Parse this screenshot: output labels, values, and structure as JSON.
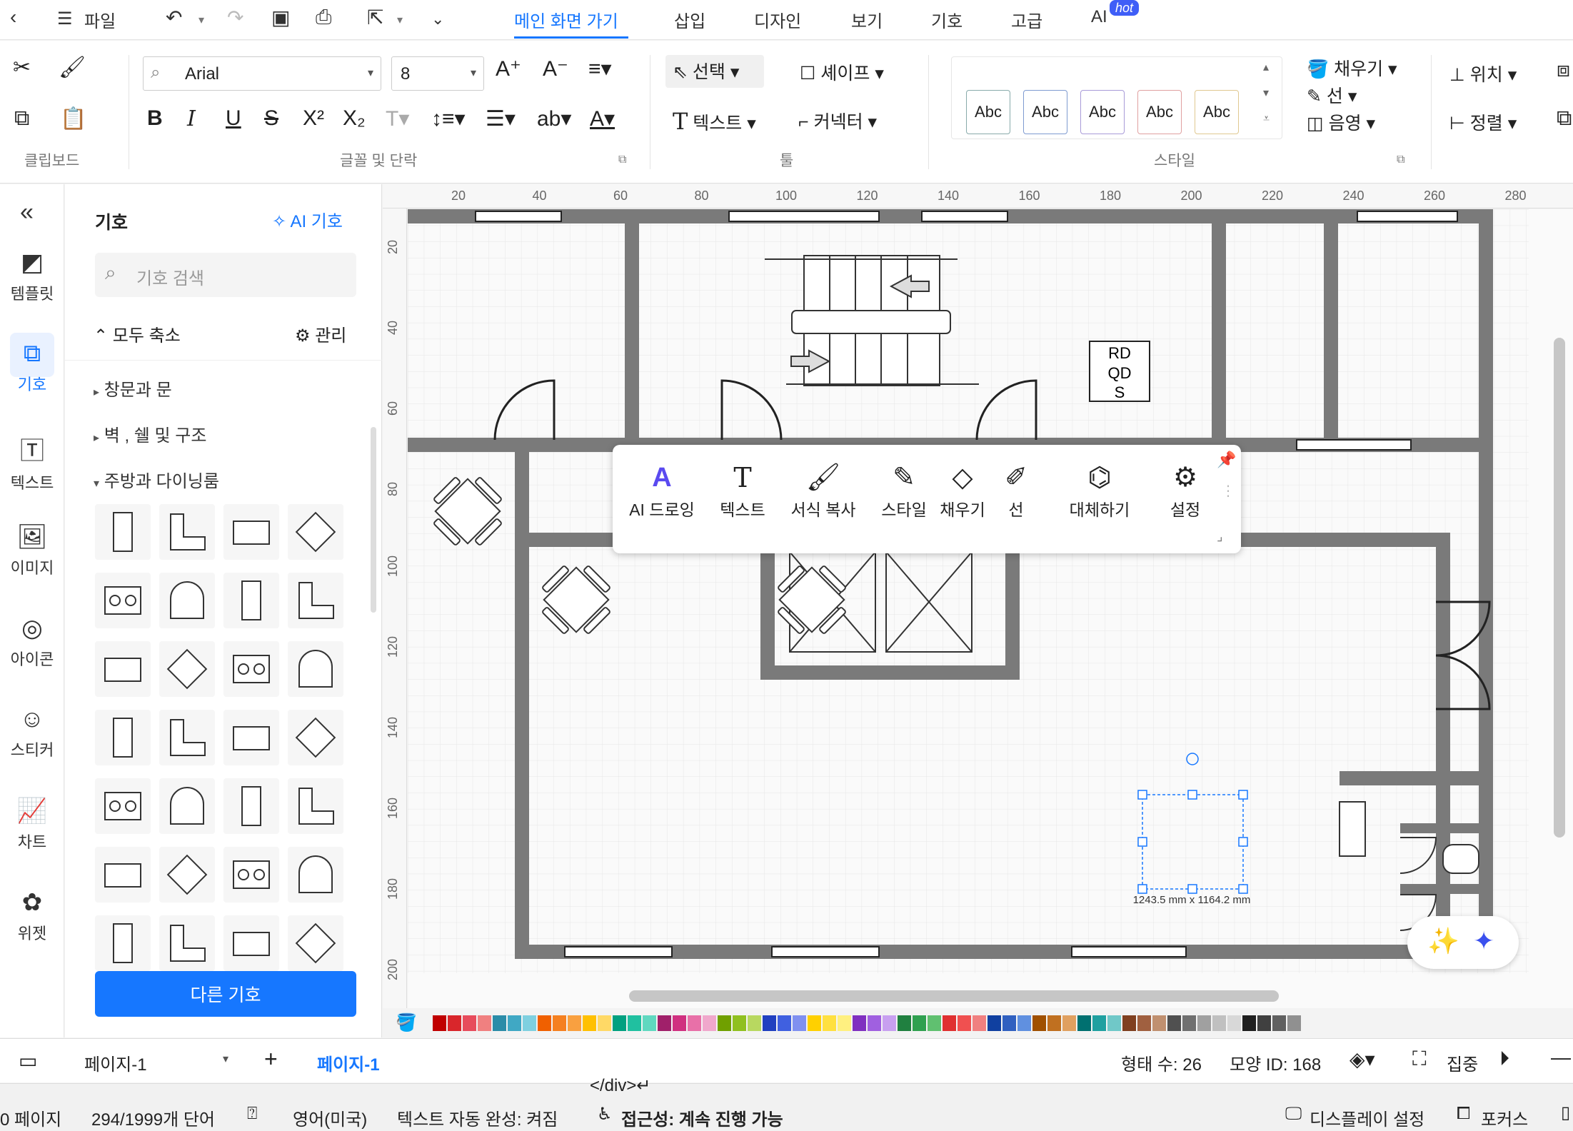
{
  "menubar": {
    "file": "파일",
    "tabs": [
      {
        "label": "메인 화면 가기",
        "active": true
      },
      {
        "label": "삽입"
      },
      {
        "label": "디자인"
      },
      {
        "label": "보기"
      },
      {
        "label": "기호"
      },
      {
        "label": "고급"
      },
      {
        "label": "AI"
      }
    ],
    "hot_badge": "hot"
  },
  "ribbon": {
    "clipboard_label": "클립보드",
    "font_label": "글꼴 및 단락",
    "tools_label": "툴",
    "style_label": "스타일",
    "font_name": "Arial",
    "font_size": "8",
    "select": "선택",
    "shape": "셰이프",
    "text": "텍스트",
    "connector": "커넥터",
    "fill": "채우기",
    "line": "선",
    "shadow": "음영",
    "position": "위치",
    "align": "정렬",
    "abc_samples": [
      "Abc",
      "Abc",
      "Abc",
      "Abc",
      "Abc"
    ]
  },
  "rail": {
    "items": [
      {
        "label": "템플릿",
        "icon": "template-icon"
      },
      {
        "label": "기호",
        "icon": "symbol-icon",
        "active": true
      },
      {
        "label": "텍스트",
        "icon": "text-icon"
      },
      {
        "label": "이미지",
        "icon": "image-icon"
      },
      {
        "label": "아이콘",
        "icon": "icon-icon"
      },
      {
        "label": "스티커",
        "icon": "sticker-icon"
      },
      {
        "label": "차트",
        "icon": "chart-icon"
      },
      {
        "label": "위젯",
        "icon": "widget-icon"
      }
    ]
  },
  "panel": {
    "title": "기호",
    "ai_symbol": "AI 기호",
    "search_placeholder": "기호 검색",
    "collapse_all": "모두 축소",
    "manage": "관리",
    "categories": [
      "창문과 문",
      "벽 , 쉘 및 구조",
      "주방과 다이닝룸"
    ],
    "more_symbols": "다른 기호"
  },
  "ruler": {
    "h": [
      "20",
      "40",
      "60",
      "80",
      "100",
      "120",
      "140",
      "160",
      "180",
      "200",
      "220",
      "240",
      "260",
      "280"
    ],
    "v": [
      "20",
      "40",
      "60",
      "80",
      "100",
      "120",
      "140",
      "160",
      "180",
      "200"
    ]
  },
  "canvas": {
    "label_rdqds": [
      "RD",
      "QD",
      "S"
    ],
    "dimension": "1243.5 mm x 1164.2 mm"
  },
  "floating_toolbar": {
    "items": [
      "AI 드로잉",
      "텍스트",
      "서식 복사",
      "스타일",
      "채우기",
      "선",
      "대체하기",
      "설정"
    ]
  },
  "colors": [
    "#c00000",
    "#d9262b",
    "#e74c5c",
    "#f08080",
    "#2b8ca8",
    "#40a8c4",
    "#7fd0e0",
    "#f06000",
    "#f58020",
    "#f9a040",
    "#ffc000",
    "#ffd966",
    "#00a080",
    "#20c0a0",
    "#60d8c0",
    "#a0206a",
    "#d03080",
    "#e870a8",
    "#f0a8cc",
    "#70a000",
    "#90c020",
    "#b8d860",
    "#2040c0",
    "#4060e0",
    "#8090f0",
    "#ffd000",
    "#ffe040",
    "#fff080",
    "#8030c0",
    "#a060e0",
    "#c8a0f0",
    "#208040",
    "#30a050",
    "#60c070",
    "#e03030",
    "#f05050",
    "#f08080",
    "#1040a0",
    "#3060c0",
    "#6090e0",
    "#a05000",
    "#c07020",
    "#e0a060",
    "#007070",
    "#20a0a0",
    "#70c8c8",
    "#804020",
    "#a06040",
    "#c09070",
    "#505050",
    "#707070",
    "#a0a0a0",
    "#c0c0c0",
    "#d8d8d8",
    "#202020",
    "#404040",
    "#606060",
    "#909090"
  ],
  "pagebar": {
    "page_select": "페이지-1",
    "page_tab": "페이지-1",
    "shape_count": "형태 수: 26",
    "shape_id": "모양 ID: 168",
    "focus": "집중"
  },
  "docbar": {
    "code": "</div>↵",
    "pages": "0 페이지",
    "words": "294/1999개 단어",
    "lang": "영어(미국)",
    "autocomplete": "텍스트 자동 완성: 켜짐",
    "accessibility": "접근성: 계속 진행 가능",
    "display": "디스플레이 설정",
    "focus": "포커스"
  }
}
